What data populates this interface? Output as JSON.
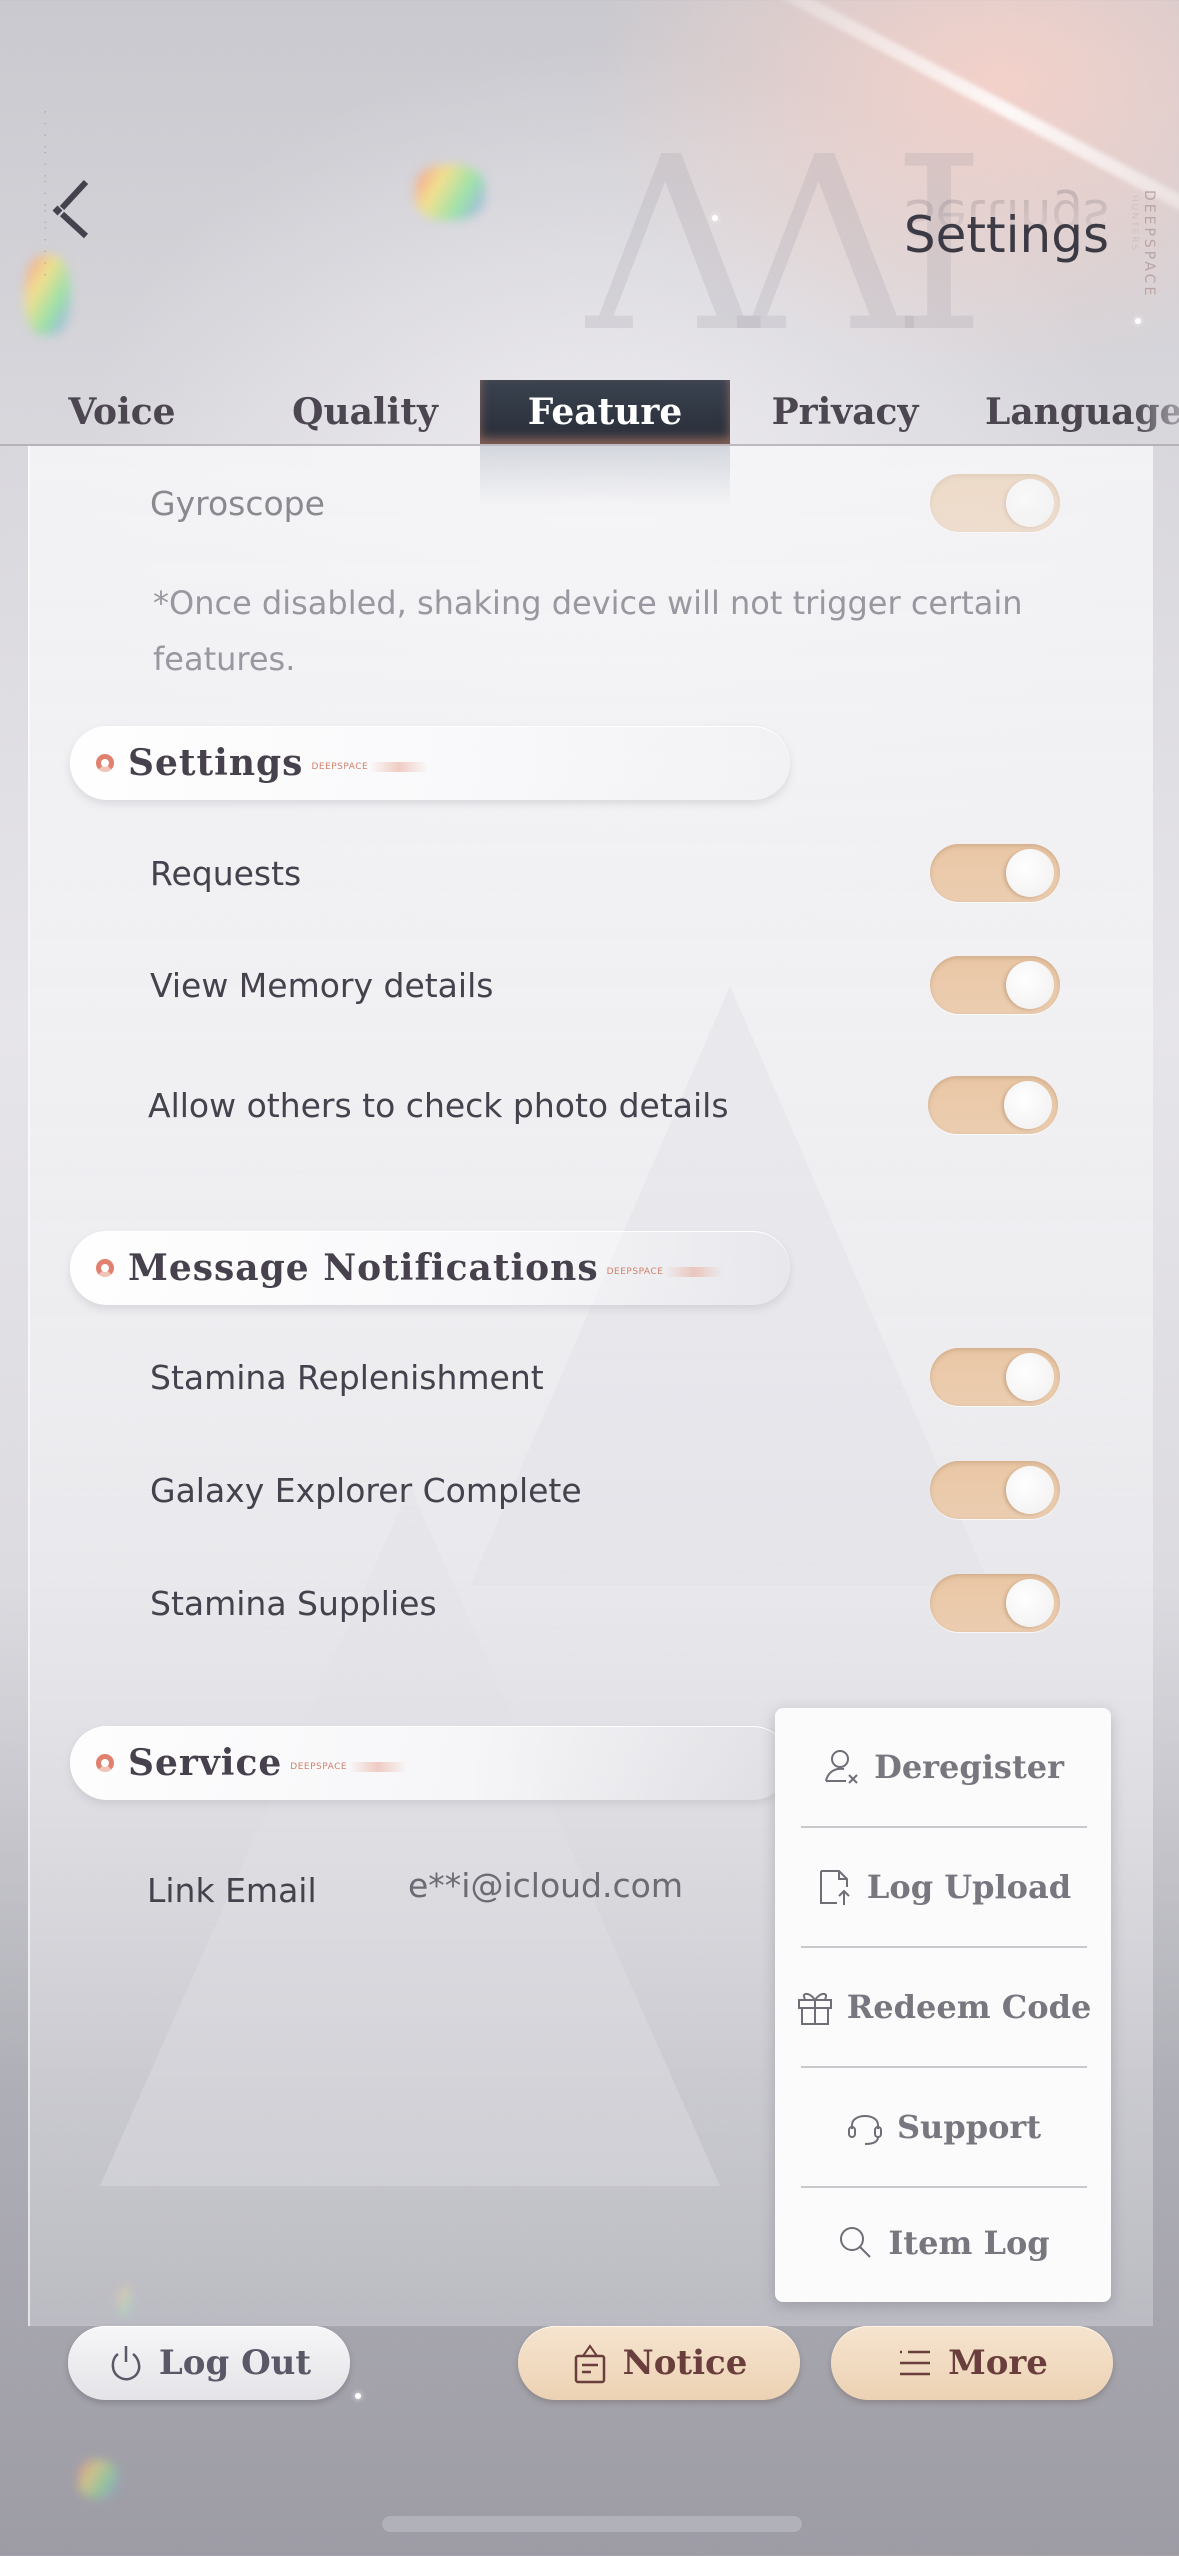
{
  "header": {
    "title": "Settings",
    "brand_line1": "DEEPSPACE",
    "brand_line2": "HUNTERS",
    "back_icon": "back-chevron-icon"
  },
  "tabs": [
    {
      "label": "Voice",
      "active": false
    },
    {
      "label": "Quality",
      "active": false
    },
    {
      "label": "Feature",
      "active": true
    },
    {
      "label": "Privacy",
      "active": false
    },
    {
      "label": "Language",
      "active": false
    }
  ],
  "feature": {
    "gyroscope": {
      "label": "Gyroscope",
      "enabled": true
    },
    "gyroscope_note": "*Once disabled, shaking device will not trigger certain features."
  },
  "sections": {
    "settings": {
      "title": "Settings",
      "tag": "DEEPSPACE",
      "items": [
        {
          "label": "Requests",
          "enabled": true
        },
        {
          "label": "View Memory details",
          "enabled": true
        },
        {
          "label": "Allow others to check photo details",
          "enabled": true
        }
      ]
    },
    "notifications": {
      "title": "Message Notifications",
      "tag": "DEEPSPACE",
      "items": [
        {
          "label": "Stamina Replenishment",
          "enabled": true
        },
        {
          "label": "Galaxy Explorer Complete",
          "enabled": true
        },
        {
          "label": "Stamina Supplies",
          "enabled": true
        }
      ]
    },
    "service": {
      "title": "Service",
      "tag": "DEEPSPACE",
      "link_email_label": "Link Email",
      "link_email_value": "e**i@icloud.com"
    }
  },
  "more_menu": {
    "items": [
      {
        "label": "Deregister",
        "icon": "user-remove-icon"
      },
      {
        "label": "Log Upload",
        "icon": "file-upload-icon"
      },
      {
        "label": "Redeem Code",
        "icon": "gift-icon"
      },
      {
        "label": "Support",
        "icon": "headset-icon"
      },
      {
        "label": "Item Log",
        "icon": "search-icon"
      }
    ]
  },
  "footer": {
    "logout_label": "Log Out",
    "notice_label": "Notice",
    "more_label": "More"
  },
  "colors": {
    "toggle_on": "#e9c7a5",
    "active_tab_bg": "#2c333f",
    "accent_ring": "#e1806f",
    "warm_button": "#f0dac0",
    "text_dark": "#45414d"
  }
}
